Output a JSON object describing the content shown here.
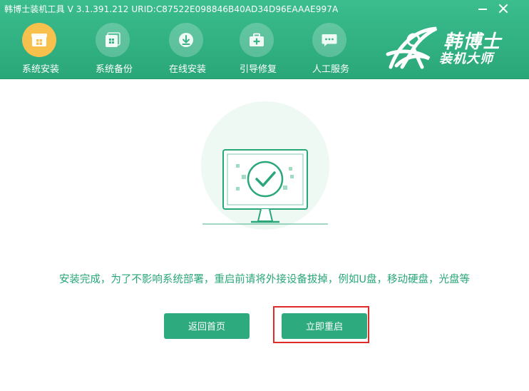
{
  "window": {
    "title": "韩博士装机工具 V 3.1.391.212 URID:C87522E098846B40AD34D96EAAAE997A",
    "minimize_icon": "minimize-icon",
    "close_icon": "close-icon"
  },
  "nav": {
    "items": [
      {
        "label": "系统安装",
        "icon": "package-icon",
        "active": true
      },
      {
        "label": "系统备份",
        "icon": "backup-icon",
        "active": false
      },
      {
        "label": "在线安装",
        "icon": "download-icon",
        "active": false
      },
      {
        "label": "引导修复",
        "icon": "toolbox-icon",
        "active": false
      },
      {
        "label": "人工服务",
        "icon": "chat-icon",
        "active": false
      }
    ]
  },
  "logo": {
    "line1": "韩博士",
    "line2": "装机大师"
  },
  "main": {
    "message": "安装完成，为了不影响系统部署，重启前请将外接设备拔掉，例如U盘，移动硬盘，光盘等",
    "btn_home": "返回首页",
    "btn_restart": "立即重启"
  },
  "colors": {
    "header": "#2eae7f",
    "accent": "#2eaa7f",
    "active_nav": "#f8c04c",
    "highlight_box": "#e02b2b"
  }
}
